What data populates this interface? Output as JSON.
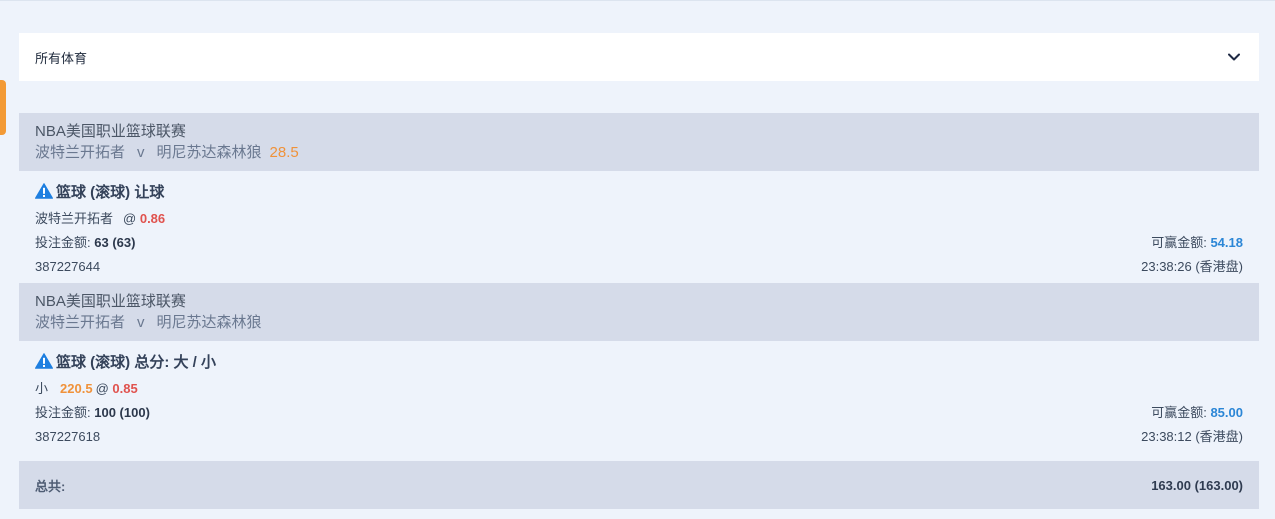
{
  "filter": {
    "label": "所有体育",
    "icon": "chevron-down-icon"
  },
  "bets": [
    {
      "league": "NBA美国职业篮球联赛",
      "home": "波特兰开拓者",
      "vs": "v",
      "away": "明尼苏达森林狼",
      "line": "28.5",
      "type": "篮球 (滚球) 让球",
      "selection": "波特兰开拓者",
      "selection_line": "",
      "at": "@",
      "odds": "0.86",
      "stake_label": "投注金额:",
      "stake": "63 (63)",
      "win_label": "可赢金额:",
      "win": "54.18",
      "ticket": "387227644",
      "time": "23:38:26 (香港盘)"
    },
    {
      "league": "NBA美国职业篮球联赛",
      "home": "波特兰开拓者",
      "vs": "v",
      "away": "明尼苏达森林狼",
      "line": "",
      "type": "篮球 (滚球) 总分: 大 / 小",
      "selection": "小",
      "selection_line": "220.5",
      "at": "@",
      "odds": "0.85",
      "stake_label": "投注金额:",
      "stake": "100 (100)",
      "win_label": "可赢金额:",
      "win": "85.00",
      "ticket": "387227618",
      "time": "23:38:12 (香港盘)"
    }
  ],
  "summary": {
    "label": "总共:",
    "value": "163.00 (163.00)"
  },
  "colors": {
    "accent_orange": "#f0923a",
    "odds_red": "#e0524e",
    "win_blue": "#2b86d6",
    "warn_blue": "#1e7fe0",
    "header_bg": "#d5dbe9",
    "page_bg": "#eef3fb"
  }
}
